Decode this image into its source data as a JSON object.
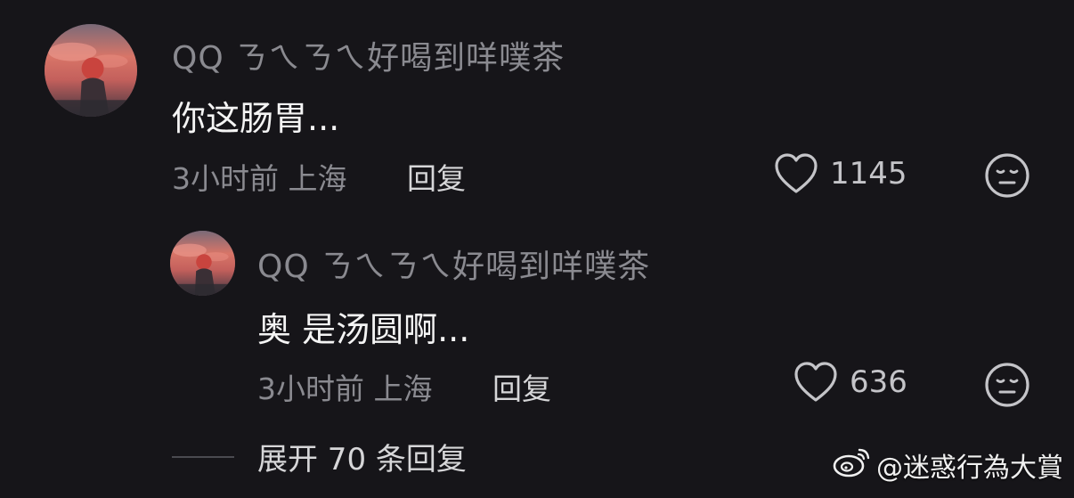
{
  "colors": {
    "background": "#161519",
    "username": "#8a8a90",
    "comment_text": "#f4f4f4",
    "meta": "#8a8a90",
    "action": "#d6d6d8"
  },
  "comment": {
    "username": "QQ ㄋㄟㄋㄟ好喝到咩噗茶",
    "text": "你这肠胃...",
    "meta": "3小时前 上海",
    "reply_label": "回复",
    "likes": "1145",
    "like_icon": "heart-outline-icon",
    "emoji_icon": "expressionless-face-icon"
  },
  "reply": {
    "username": "QQ ㄋㄟㄋㄟ好喝到咩噗茶",
    "text": "奥 是汤圆啊...",
    "meta": "3小时前 上海",
    "reply_label": "回复",
    "likes": "636",
    "like_icon": "heart-outline-icon",
    "emoji_icon": "expressionless-face-icon"
  },
  "expand": {
    "label": "展开 70 条回复"
  },
  "watermark": {
    "text": "@迷惑行為大賞",
    "icon": "weibo-logo-icon"
  }
}
